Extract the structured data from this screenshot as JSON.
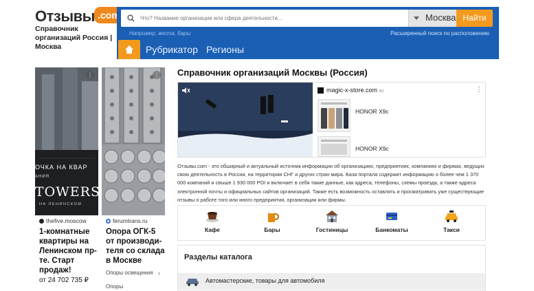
{
  "logo": {
    "word": "Отзывы",
    "com": ".com"
  },
  "tagline": "Справочник организаций Россия | Москва",
  "search": {
    "placeholder": "Что? Название организации или сфера деятельности...",
    "city": "Москва",
    "button": "Найти",
    "hint": "Например, веста, бары",
    "advanced": "Расширенный поиск по расположению"
  },
  "nav": {
    "items": [
      "Рубрикатор",
      "Регионы"
    ]
  },
  "ads": [
    {
      "overlay_line1": "ОЧКА НА КВАР",
      "overlay_line2": "АНИЯ",
      "overlay_brand": "TOWERS",
      "overlay_sub": "НА ЛЕНИНСКОМ",
      "source": "thefive.moscow",
      "title": "1-комнатные квартиры на Ленинском пр-те. Старт продаж!",
      "price": "от 24 702 735 ₽"
    },
    {
      "source": "ferumtrans.ru",
      "title": "Опора ОГК-5 от производи-теля со склада в Москве",
      "sub": "Опоры освещения",
      "sub2": "Опоры"
    }
  ],
  "main": {
    "title": "Справочник организаций Москвы (Россия)",
    "video_ad": {
      "store": "magic-x-store.com",
      "ad_mark": "AD",
      "products": [
        "HONOR X9c",
        "HONOR X9c"
      ]
    },
    "description": "Отзывы.com - это обширный и актуальный источник информации об организациях, предприятиях, компаниях и фирмах, ведущих свою деятельность в России, на территории СНГ и других стран мира. База портала содержит информацию о более чем 1 370 000 компаний и свыше 1 930 000 POI и включает в себя такие данные, как адреса, телефоны, схемы проезда, а также адреса электронной почты и официальных сайтов организаций. Также есть возможность оставлять и просматривать уже существующие отзывы о работе того или иного предприятия, организации или фирмы.",
    "categories": [
      {
        "label": "Кафе",
        "icon": "coffee-cup-icon"
      },
      {
        "label": "Бары",
        "icon": "beer-mug-icon"
      },
      {
        "label": "Гостиницы",
        "icon": "hotel-icon"
      },
      {
        "label": "Банкоматы",
        "icon": "atm-card-icon"
      },
      {
        "label": "Такси",
        "icon": "taxi-icon"
      }
    ],
    "sections_title": "Разделы каталога",
    "sections_first": "Автомастерские, товары для автомобиля"
  },
  "colors": {
    "header_blue": "#1a5fb4",
    "accent_orange": "#f39a1e"
  }
}
